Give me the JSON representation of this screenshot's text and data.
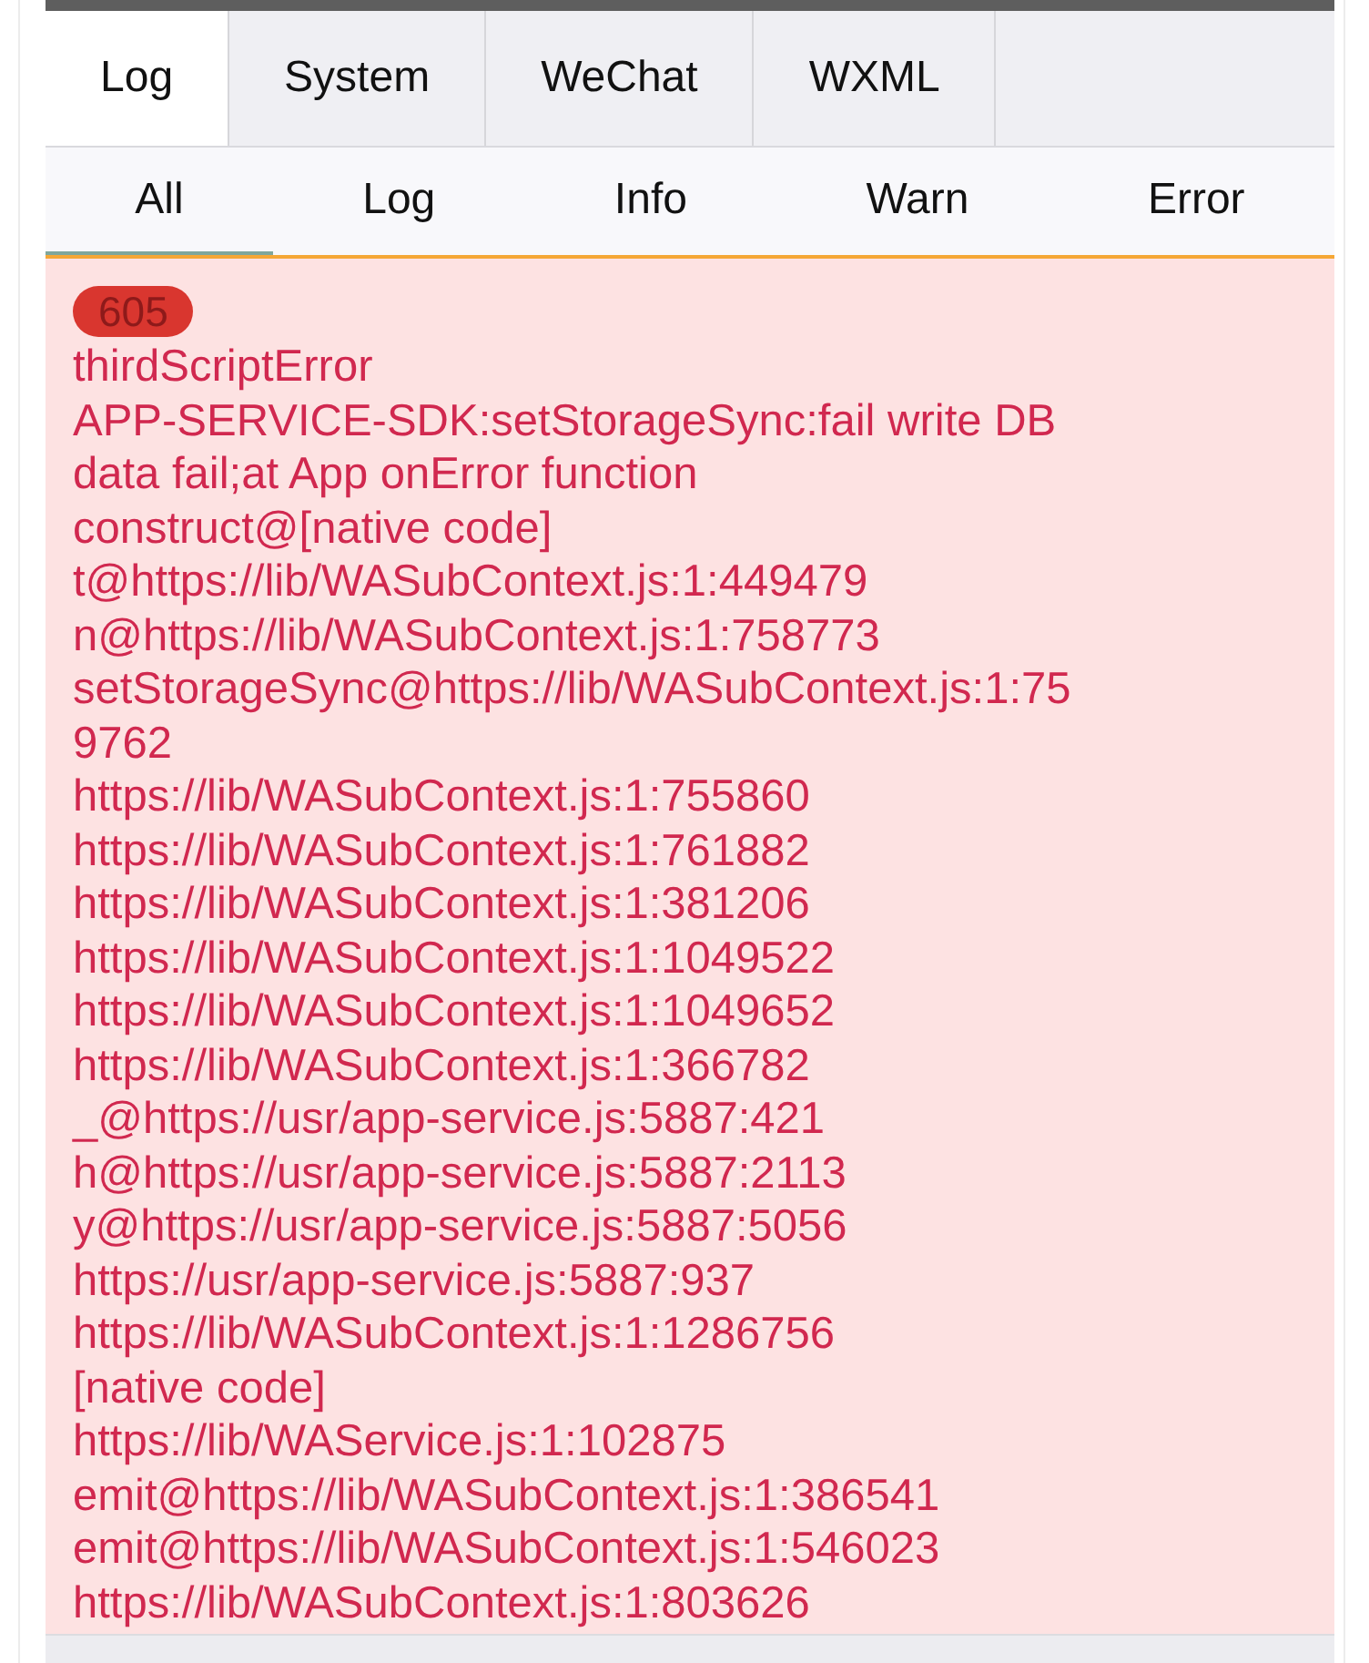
{
  "tabs": [
    {
      "label": "Log",
      "selected": true
    },
    {
      "label": "System",
      "selected": false
    },
    {
      "label": "WeChat",
      "selected": false
    },
    {
      "label": "WXML",
      "selected": false
    }
  ],
  "filters": [
    {
      "label": "All",
      "selected": true
    },
    {
      "label": "Log",
      "selected": false
    },
    {
      "label": "Info",
      "selected": false
    },
    {
      "label": "Warn",
      "selected": false
    },
    {
      "label": "Error",
      "selected": false
    }
  ],
  "log_entries": [
    {
      "kind": "error",
      "count": "605",
      "lines": [
        "thirdScriptError",
        "APP-SERVICE-SDK:setStorageSync:fail write DB",
        "data fail;at App onError function",
        "construct@[native code]",
        "t@https://lib/WASubContext.js:1:449479",
        "n@https://lib/WASubContext.js:1:758773",
        "setStorageSync@https://lib/WASubContext.js:1:75",
        "9762",
        "https://lib/WASubContext.js:1:755860",
        "https://lib/WASubContext.js:1:761882",
        "https://lib/WASubContext.js:1:381206",
        "https://lib/WASubContext.js:1:1049522",
        "https://lib/WASubContext.js:1:1049652",
        "https://lib/WASubContext.js:1:366782",
        "_@https://usr/app-service.js:5887:421",
        "h@https://usr/app-service.js:5887:2113",
        "y@https://usr/app-service.js:5887:5056",
        "https://usr/app-service.js:5887:937",
        "https://lib/WASubContext.js:1:1286756",
        "[native code]",
        "https://lib/WAService.js:1:102875",
        "emit@https://lib/WASubContext.js:1:386541",
        "emit@https://lib/WASubContext.js:1:546023",
        "https://lib/WASubContext.js:1:803626"
      ]
    }
  ]
}
